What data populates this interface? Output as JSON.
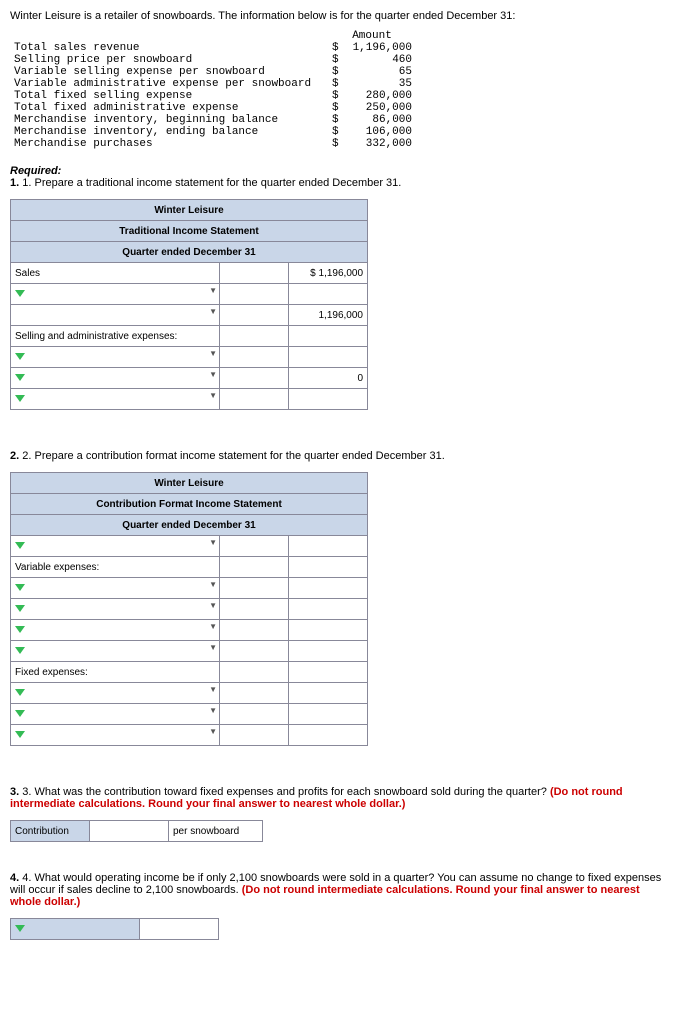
{
  "intro": "Winter Leisure is a retailer of snowboards. The information below is for the quarter ended December 31:",
  "amount_header": "Amount",
  "rows": [
    {
      "desc": "Total sales revenue",
      "cur": "$",
      "val": "1,196,000"
    },
    {
      "desc": "Selling price per snowboard",
      "cur": "$",
      "val": "460"
    },
    {
      "desc": "Variable selling expense per snowboard",
      "cur": "$",
      "val": "65"
    },
    {
      "desc": "Variable administrative expense per snowboard",
      "cur": "$",
      "val": "35"
    },
    {
      "desc": "Total fixed selling expense",
      "cur": "$",
      "val": "280,000"
    },
    {
      "desc": "Total fixed administrative expense",
      "cur": "$",
      "val": "250,000"
    },
    {
      "desc": "Merchandise inventory, beginning balance",
      "cur": "$",
      "val": "86,000"
    },
    {
      "desc": "Merchandise inventory, ending balance",
      "cur": "$",
      "val": "106,000"
    },
    {
      "desc": "Merchandise purchases",
      "cur": "$",
      "val": "332,000"
    }
  ],
  "required_label": "Required:",
  "q1": "1. Prepare a traditional income statement for the quarter ended December 31.",
  "t1": {
    "h1": "Winter Leisure",
    "h2": "Traditional Income Statement",
    "h3": "Quarter ended December 31",
    "sales": "Sales",
    "sales_amt": "$ 1,196,000",
    "sub_amt": "1,196,000",
    "sae": "Selling and administrative expenses:",
    "zero": "0"
  },
  "q2": "2. Prepare a contribution format income statement for the quarter ended December 31.",
  "t2": {
    "h1": "Winter Leisure",
    "h2": "Contribution Format Income Statement",
    "h3": "Quarter ended December 31",
    "ve": "Variable expenses:",
    "fe": "Fixed expenses:"
  },
  "q3a": "3. What was the contribution toward fixed expenses and profits for each snowboard sold during the quarter? ",
  "q3b": "(Do not round intermediate calculations. Round your final answer to nearest whole dollar.)",
  "contrib": "Contribution",
  "per": "per snowboard",
  "q4a": "4. What would operating income be if only 2,100 snowboards were sold in a quarter? You can assume no change to fixed expenses will occur if sales decline to 2,100 snowboards. ",
  "q4b": "(Do not round intermediate calculations. Round your final answer to nearest whole dollar.)"
}
